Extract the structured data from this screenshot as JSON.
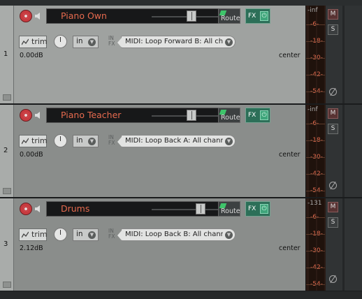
{
  "tracks": [
    {
      "number": "1",
      "name": "Piano Own",
      "volume": "0.00dB",
      "pan": "center",
      "trim_label": "trim",
      "input_mode": "in",
      "fx_in_label": "IN\nFX",
      "midi_input": "MIDI: Loop Forward B: All chan",
      "route_label": "Route",
      "fx_label": "FX",
      "meter_peak": "-inf",
      "meter_ticks": [
        "-6-",
        "-18-",
        "-30-",
        "-42-",
        "-54-"
      ],
      "mute_label": "M",
      "solo_label": "S",
      "fader_value": 0.77,
      "bg_color": "#9fa2a0"
    },
    {
      "number": "2",
      "name": "Piano Teacher",
      "volume": "0.00dB",
      "pan": "center",
      "trim_label": "trim",
      "input_mode": "in",
      "fx_in_label": "IN\nFX",
      "midi_input": "MIDI: Loop Back A: All channel:",
      "route_label": "Route",
      "fx_label": "FX",
      "meter_peak": "-inf",
      "meter_ticks": [
        "-6-",
        "-18-",
        "-30-",
        "-42-",
        "-54-"
      ],
      "mute_label": "M",
      "solo_label": "S",
      "fader_value": 0.77,
      "bg_color": "#8a8d8b"
    },
    {
      "number": "3",
      "name": "Drums",
      "volume": "2.12dB",
      "pan": "center",
      "trim_label": "trim",
      "input_mode": "in",
      "fx_in_label": "IN\nFX",
      "midi_input": "MIDI: Loop Back B: All channel:",
      "route_label": "Route",
      "fx_label": "FX",
      "meter_peak": "-131",
      "meter_ticks": [
        "-6-",
        "-18-",
        "-30-",
        "-42-",
        "-54-"
      ],
      "mute_label": "M",
      "solo_label": "S",
      "fader_value": 0.82,
      "bg_color": "#8a8d8b"
    }
  ],
  "colors": {
    "track_name": "#e66a4e",
    "meter_tick": "#e06a4e",
    "fx_active": "#2c6f58",
    "record_arm": "#c83a3f"
  }
}
